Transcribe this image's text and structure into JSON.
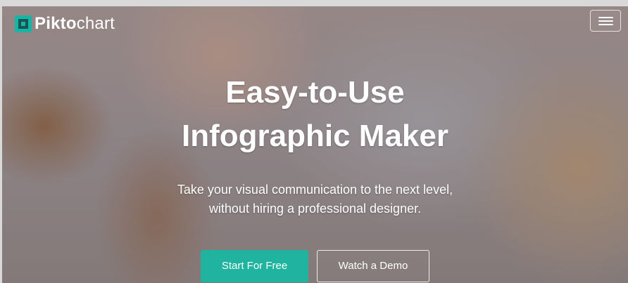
{
  "brand": {
    "logo_text_strong": "Pikto",
    "logo_text_light": "chart",
    "logo_icon": "piktochart-logo-icon",
    "accent_color": "#1fb3a0"
  },
  "nav": {
    "menu_icon": "hamburger-menu-icon"
  },
  "hero": {
    "headline_line1": "Easy-to-Use",
    "headline_line2": "Infographic Maker",
    "subtitle_line1": "Take your visual communication to the next level,",
    "subtitle_line2": "without hiring a professional designer."
  },
  "actions": {
    "primary_label": "Start For Free",
    "secondary_label": "Watch a Demo"
  }
}
